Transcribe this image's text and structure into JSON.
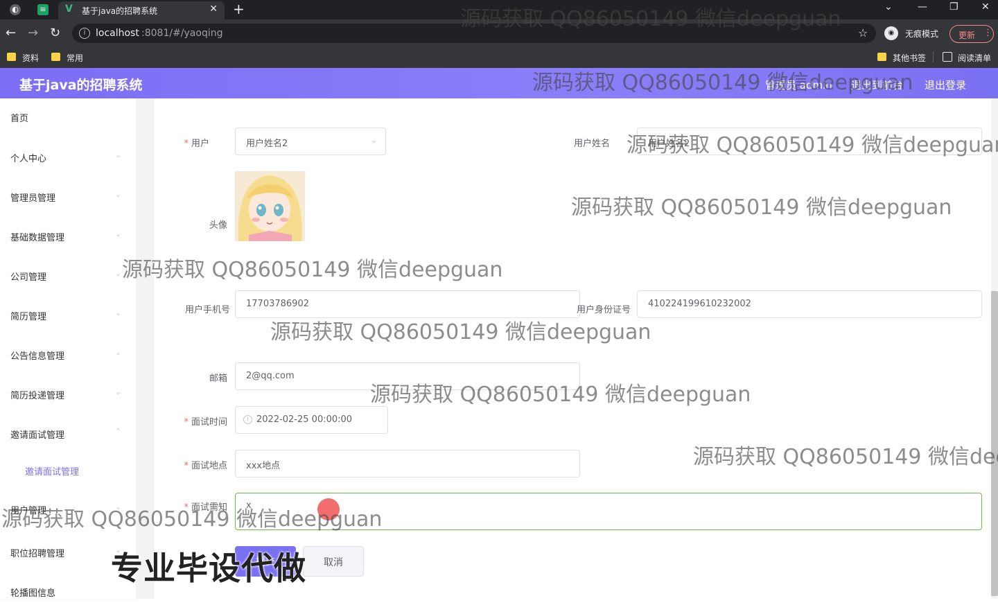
{
  "browser": {
    "tab_title": "基于java的招聘系统",
    "url_host": "localhost",
    "url_path": ":8081/#/yaoqing",
    "incognito_label": "无痕模式",
    "update_label": "更新",
    "bookmarks_left": [
      "资料",
      "常用"
    ],
    "bookmarks_right": [
      "其他书签",
      "阅读清单"
    ]
  },
  "header": {
    "title": "基于java的招聘系统",
    "user": "管理员 admin",
    "back_label": "退出到前台",
    "logout_label": "退出登录"
  },
  "sidebar": {
    "items": [
      "首页",
      "个人中心",
      "管理员管理",
      "基础数据管理",
      "公司管理",
      "简历管理",
      "公告信息管理",
      "简历投递管理",
      "邀请面试管理"
    ],
    "active_sub": "邀请面试管理",
    "items_after": [
      "用户管理",
      "职位招聘管理",
      "轮播图信息"
    ]
  },
  "form": {
    "user_label": "用户",
    "user_value": "用户姓名2",
    "user_name_label": "用户姓名",
    "user_name_value": "用户姓名2",
    "avatar_label": "头像",
    "phone_label": "用户手机号",
    "phone_value": "17703786902",
    "id_label": "用户身份证号",
    "id_value": "410224199610232002",
    "email_label": "邮箱",
    "email_value": "2@qq.com",
    "time_label": "面试时间",
    "time_value": "2022-02-25 00:00:00",
    "place_label": "面试地点",
    "place_value": "xxx地点",
    "notice_label": "面试需知",
    "notice_value": "x",
    "submit_label": "提交",
    "cancel_label": "取消"
  },
  "overlay": {
    "watermark": "源码获取 QQ86050149 微信deepguan",
    "watermark_cut": "源码获取 QQ86050149 微信dee",
    "promo": "专业毕设代做"
  },
  "colors": {
    "accent": "#7a70f2",
    "required": "#f56c6c",
    "focus": "#67c23a"
  }
}
